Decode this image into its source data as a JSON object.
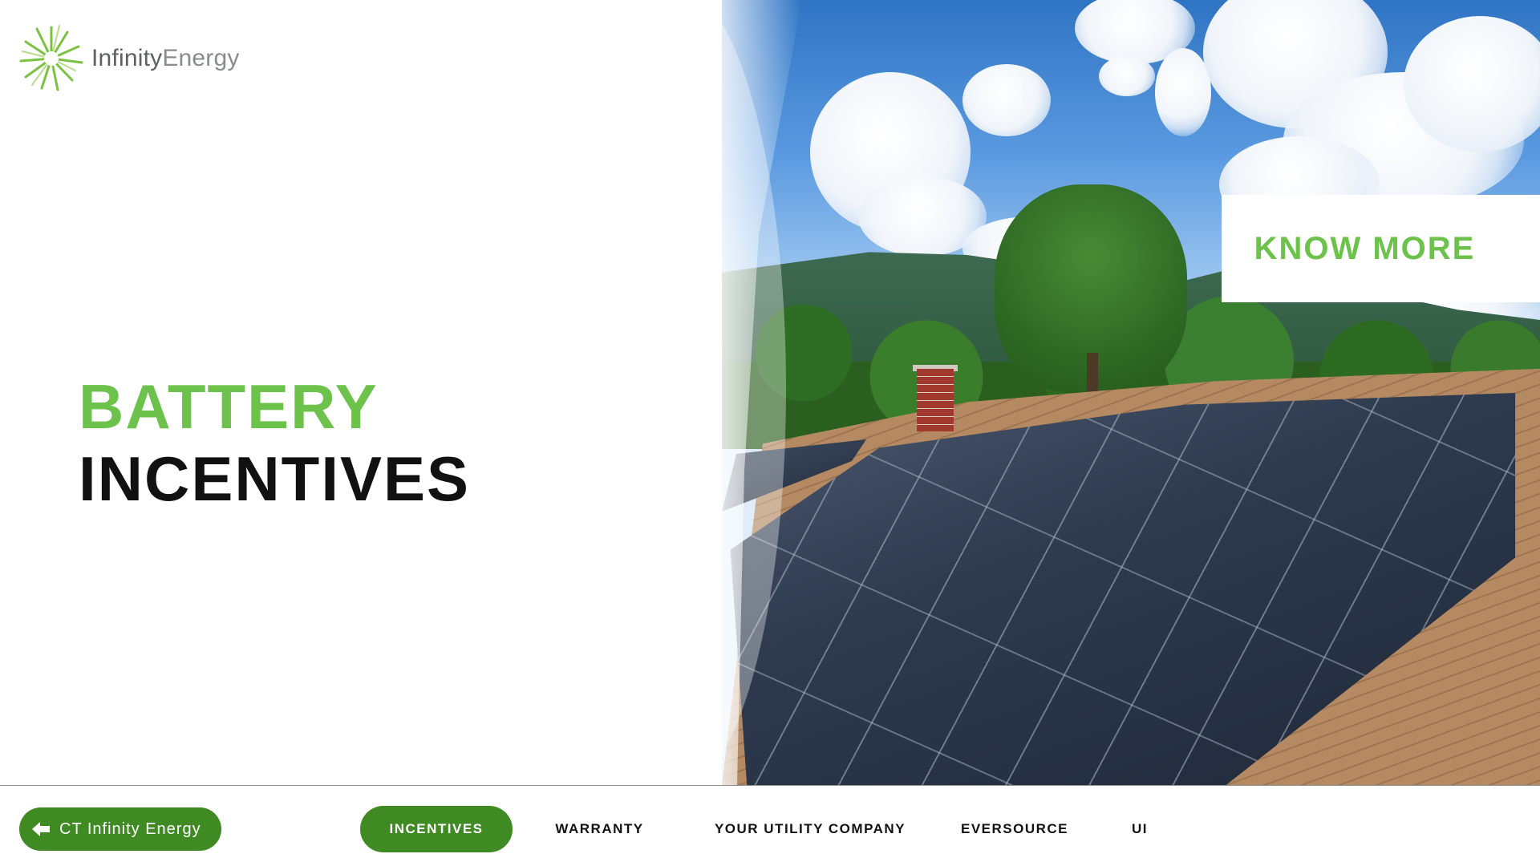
{
  "brand": {
    "name_part1": "Infinity",
    "name_part2": "Energy",
    "logo_color": "#7cc242"
  },
  "title": {
    "line1": "BATTERY",
    "line2": "INCENTIVES"
  },
  "cta": {
    "label": "KNOW MORE"
  },
  "footer": {
    "back_button": "CT Infinity Energy",
    "tabs": [
      {
        "label": "INCENTIVES",
        "active": true
      },
      {
        "label": "WARRANTY",
        "active": false
      },
      {
        "label": "YOUR UTILITY COMPANY",
        "active": false
      },
      {
        "label": "EVERSOURCE",
        "active": false
      },
      {
        "label": "UI",
        "active": false
      }
    ]
  },
  "colors": {
    "accent_green": "#6cc24a",
    "button_green": "#3f8a22",
    "text_dark": "#111111"
  },
  "icons": {
    "logo": "sunburst-logo-icon",
    "back": "arrow-left-icon"
  }
}
